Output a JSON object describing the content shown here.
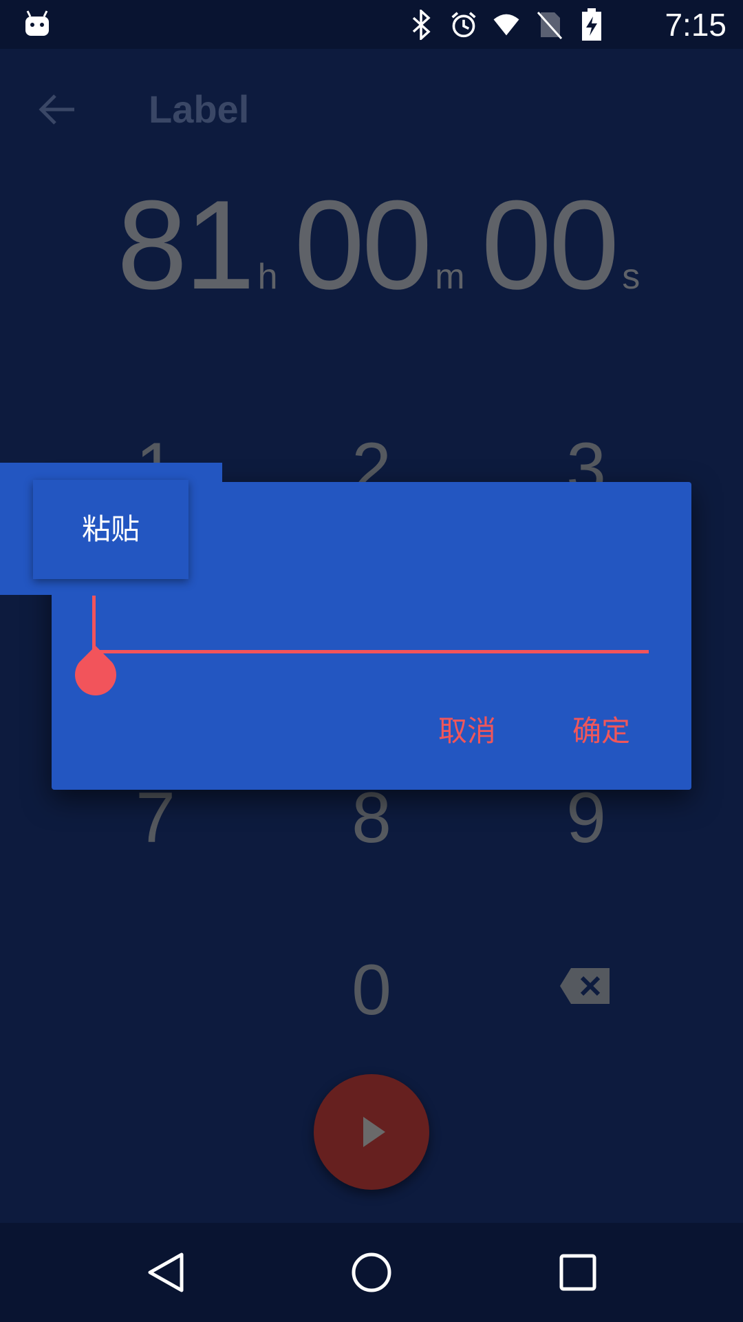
{
  "status_bar": {
    "time": "7:15",
    "icons": [
      "android-debug-icon",
      "bluetooth-icon",
      "alarm-icon",
      "wifi-icon",
      "no-sim-icon",
      "battery-charging-icon"
    ]
  },
  "toolbar": {
    "title": "Label",
    "back_icon": "arrow-back-icon"
  },
  "timer_display": {
    "hours": "81",
    "hours_unit": "h",
    "minutes": "00",
    "minutes_unit": "m",
    "seconds": "00",
    "seconds_unit": "s"
  },
  "keypad": {
    "keys": [
      "1",
      "2",
      "3",
      "7",
      "8",
      "9",
      "0"
    ],
    "backspace_icon": "backspace-icon"
  },
  "fab": {
    "icon": "play-icon"
  },
  "dialog": {
    "input_value": "",
    "cancel_label": "取消",
    "ok_label": "确定"
  },
  "paste_popup": {
    "label": "粘贴"
  },
  "nav_bar": {
    "icons": [
      "back-triangle-icon",
      "home-circle-icon",
      "recents-square-icon"
    ]
  },
  "colors": {
    "background": "#0d1b3e",
    "dialog": "#2356c1",
    "accent": "#f2545b",
    "fab": "#66201f"
  }
}
